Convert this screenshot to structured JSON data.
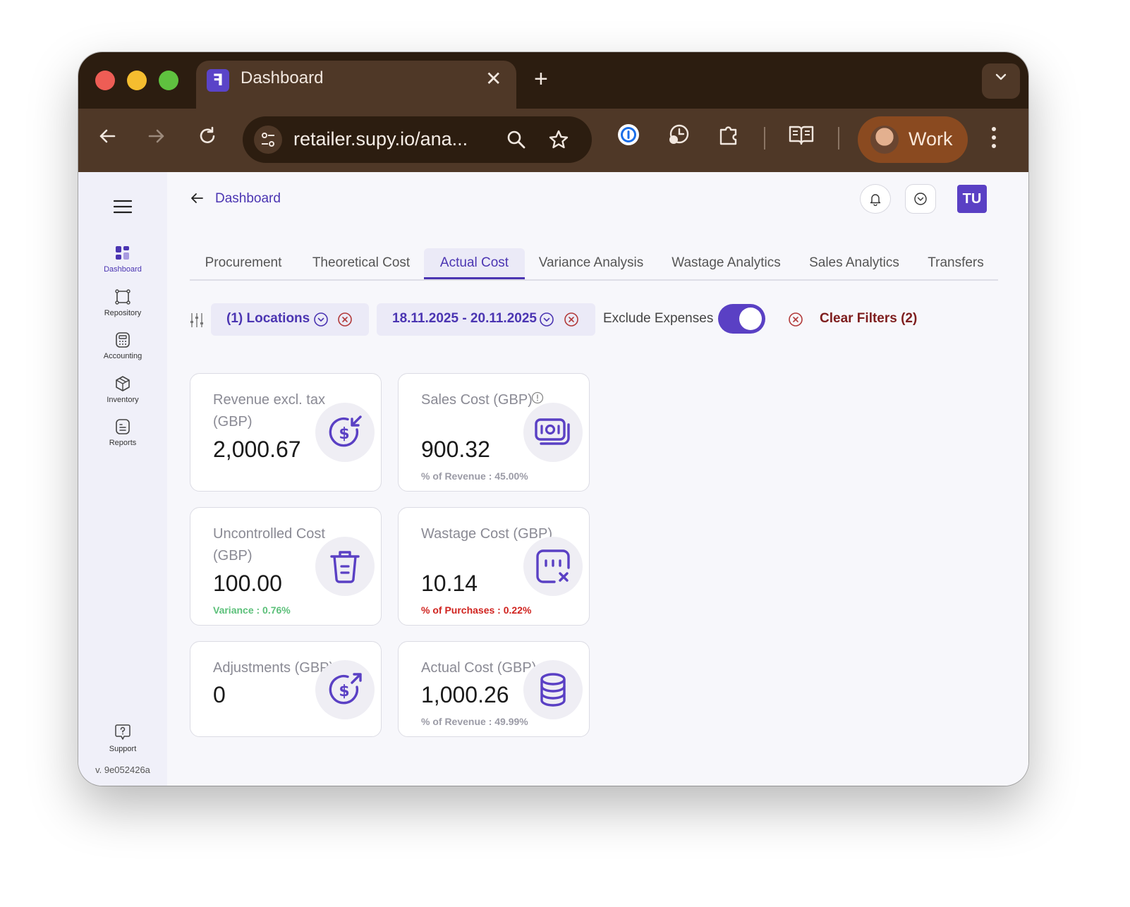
{
  "browser": {
    "tab_title": "Dashboard",
    "url": "retailer.supy.io/ana...",
    "profile_name": "Work"
  },
  "sidebar": {
    "items": [
      {
        "label": "Dashboard",
        "icon": "dashboard-icon",
        "active": true
      },
      {
        "label": "Repository",
        "icon": "repository-icon"
      },
      {
        "label": "Accounting",
        "icon": "calculator-icon"
      },
      {
        "label": "Inventory",
        "icon": "box-icon"
      },
      {
        "label": "Reports",
        "icon": "report-icon"
      }
    ],
    "support_label": "Support",
    "version": "v. 9e052426a"
  },
  "header": {
    "breadcrumb": "Dashboard",
    "avatar_initials": "TU"
  },
  "tabs": [
    {
      "label": "Procurement"
    },
    {
      "label": "Theoretical Cost"
    },
    {
      "label": "Actual Cost",
      "active": true
    },
    {
      "label": "Variance Analysis"
    },
    {
      "label": "Wastage Analytics"
    },
    {
      "label": "Sales Analytics"
    },
    {
      "label": "Transfers"
    }
  ],
  "filters": {
    "locations": "(1) Locations",
    "date_range": "18.11.2025 - 20.11.2025",
    "exclude_expenses_label": "Exclude Expenses",
    "exclude_expenses_on": true,
    "clear_label": "Clear Filters (2)"
  },
  "cards": [
    {
      "title": "Revenue excl. tax (GBP)",
      "value": "2,000.67",
      "sub": ""
    },
    {
      "title": "Sales Cost (GBP)",
      "value": "900.32",
      "sub": "% of Revenue : 45.00%",
      "sub_color": "grey"
    },
    {
      "title": "Uncontrolled Cost (GBP)",
      "value": "100.00",
      "sub": "Variance : 0.76%",
      "sub_color": "green"
    },
    {
      "title": "Wastage Cost (GBP)",
      "value": "10.14",
      "sub": "% of Purchases : 0.22%",
      "sub_color": "red"
    },
    {
      "title": "Adjustments (GBP)",
      "value": "0",
      "sub": ""
    },
    {
      "title": "Actual Cost (GBP)",
      "value": "1,000.26",
      "sub": "% of Revenue : 49.99%",
      "sub_color": "grey"
    }
  ],
  "colors": {
    "accent": "#4b35b2",
    "toggle": "#5a40c4",
    "danger": "#7e1e1e",
    "chrome_dark": "#2c1d10",
    "chrome_toolbar": "#4f3827"
  }
}
